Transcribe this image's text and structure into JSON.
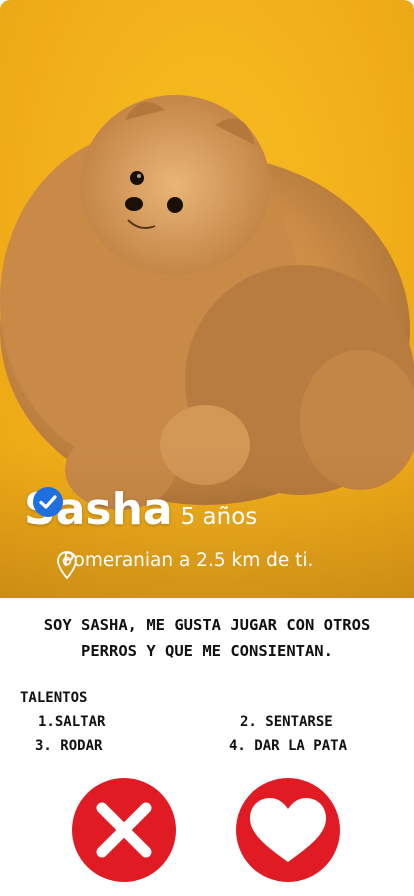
{
  "profile": {
    "name": "Sasha",
    "age": "5 años",
    "location": "Pomeranian a 2.5 km de ti."
  },
  "bio": {
    "line1": "SOY SASHA, ME GUSTA JUGAR CON OTROS",
    "line2": "PERROS Y QUE ME CONSIENTAN."
  },
  "talents": {
    "title": "TALENTOS",
    "items": [
      "1.SALTAR",
      "2. SENTARSE",
      "3. RODAR",
      "4. DAR LA PATA"
    ]
  },
  "icons": {
    "verified": "verified-check-icon",
    "location": "location-pin-icon",
    "reject": "x-icon",
    "like": "heart-icon"
  },
  "colors": {
    "background": "#f2b01a",
    "verified": "#1f6fe0",
    "action": "#e01b24"
  }
}
